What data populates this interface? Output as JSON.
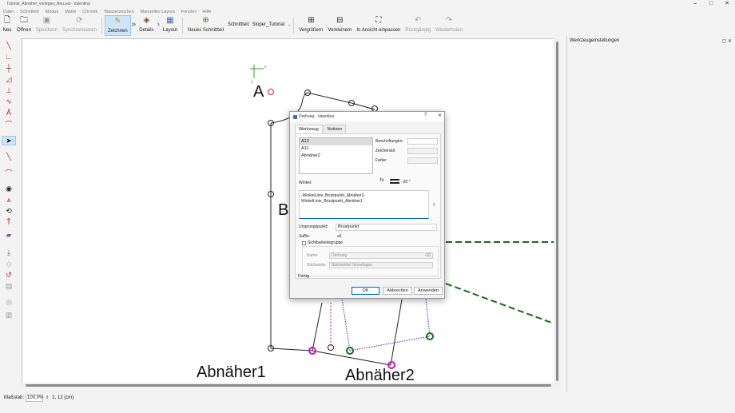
{
  "window": {
    "title": "Tutorial_Abnäher_verlegen_Neu.val - Valentina",
    "controls": [
      "–",
      "□",
      "✕"
    ]
  },
  "menu": [
    "Datei",
    "Schnittteil",
    "Modus",
    "Maße",
    "Chronik",
    "Wasserzeichen",
    "Manuelles Layout",
    "Fenster",
    "Hilfe"
  ],
  "toolbar": {
    "neu": "Neu",
    "offnen": "Öffnen",
    "speichern": "Speichern",
    "sync": "Synchronisieren",
    "zeichnen": "Zeichnen",
    "details": "Details",
    "layout": "Layout",
    "neues_schnittteil": "Neues Schnittteil",
    "schnittteil_label": "Schnittteil:",
    "schnittteil_value": "Sloper_Tutorial",
    "vergroessern": "Vergrößern",
    "verkleinern": "Verkleinern",
    "ansicht": "In Ansicht einpassen",
    "rueckgaengig": "Rückgängig",
    "wiederholen": "Wiederholen"
  },
  "canvas": {
    "labels": {
      "a": "A",
      "br": "Br",
      "abnaeher1": "Abnäher1",
      "abnaeher2": "Abnäher2",
      "axis_x": "x",
      "axis_y": "y"
    }
  },
  "right_panel": {
    "title": "Werkzeugeinstellungen",
    "controls": "▢ ✕"
  },
  "statusbar": {
    "scale_label": "Maßstab:",
    "scale_value": "100,0%",
    "coords": "2, 12 (cm)"
  },
  "dialog": {
    "title": "Drehung - Valentina",
    "help": "?",
    "close": "✕",
    "tabs": [
      "Werkzeug",
      "Notizen"
    ],
    "objects": [
      "A12",
      "A11",
      "Abnäher2"
    ],
    "labels_field": "Beschriftungen:",
    "style_field": "Zeichenstil:",
    "color_field": "Farbe:",
    "winkel_label": "Winkel:",
    "fx": "fx",
    "angle_value": "-20 °",
    "formula_line1": "-WinkelLinie_Brustpunkt_Abnäher2-",
    "formula_line2": "WinkelLinie_Brustpunkt_Abnäher1",
    "origin_label": "Ursprungspunkt:",
    "origin_value": "Brustpunkt",
    "suffix_label": "Suffix:",
    "suffix_value": "a1",
    "visgroup_label": "Sichtbarkeitsgruppe",
    "name_label": "Name:",
    "name_placeholder": "Drehung",
    "tags_label": "Stichworte:",
    "tags_placeholder": "Stichwörter hinzufügen",
    "fertig": "Fertig",
    "ok": "OK",
    "cancel": "Abbrechen",
    "apply": "Anwenden"
  }
}
